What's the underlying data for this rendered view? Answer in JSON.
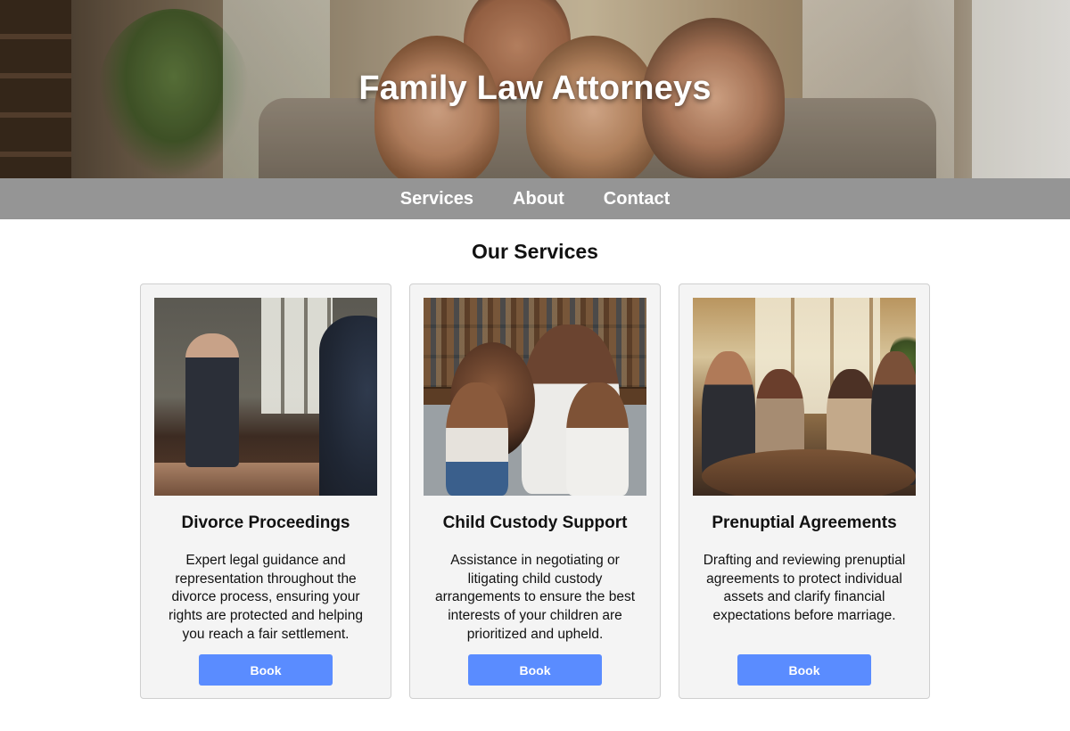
{
  "hero": {
    "title": "Family Law Attorneys",
    "image_description": "photo-family-on-couch"
  },
  "nav": {
    "items": [
      {
        "label": "Services"
      },
      {
        "label": "About"
      },
      {
        "label": "Contact"
      }
    ]
  },
  "services": {
    "title": "Our Services",
    "cards": [
      {
        "image": "photo-lawyer-in-office",
        "title": "Divorce Proceedings",
        "description": "Expert legal guidance and representation throughout the divorce process, ensuring your rights are protected and helping you reach a fair settlement.",
        "button": "Book"
      },
      {
        "image": "photo-family-on-couch",
        "title": "Child Custody Support",
        "description": "Assistance in negotiating or litigating child custody arrangements to ensure the best interests of your children are prioritized and upheld.",
        "button": "Book"
      },
      {
        "image": "photo-meeting-at-table",
        "title": "Prenuptial Agreements",
        "description": "Drafting and reviewing prenuptial agreements to protect individual assets and clarify financial expectations before marriage.",
        "button": "Book"
      }
    ]
  },
  "colors": {
    "nav_bg": "#959595",
    "button_bg": "#5a8cff",
    "card_bg": "#f4f4f4"
  }
}
